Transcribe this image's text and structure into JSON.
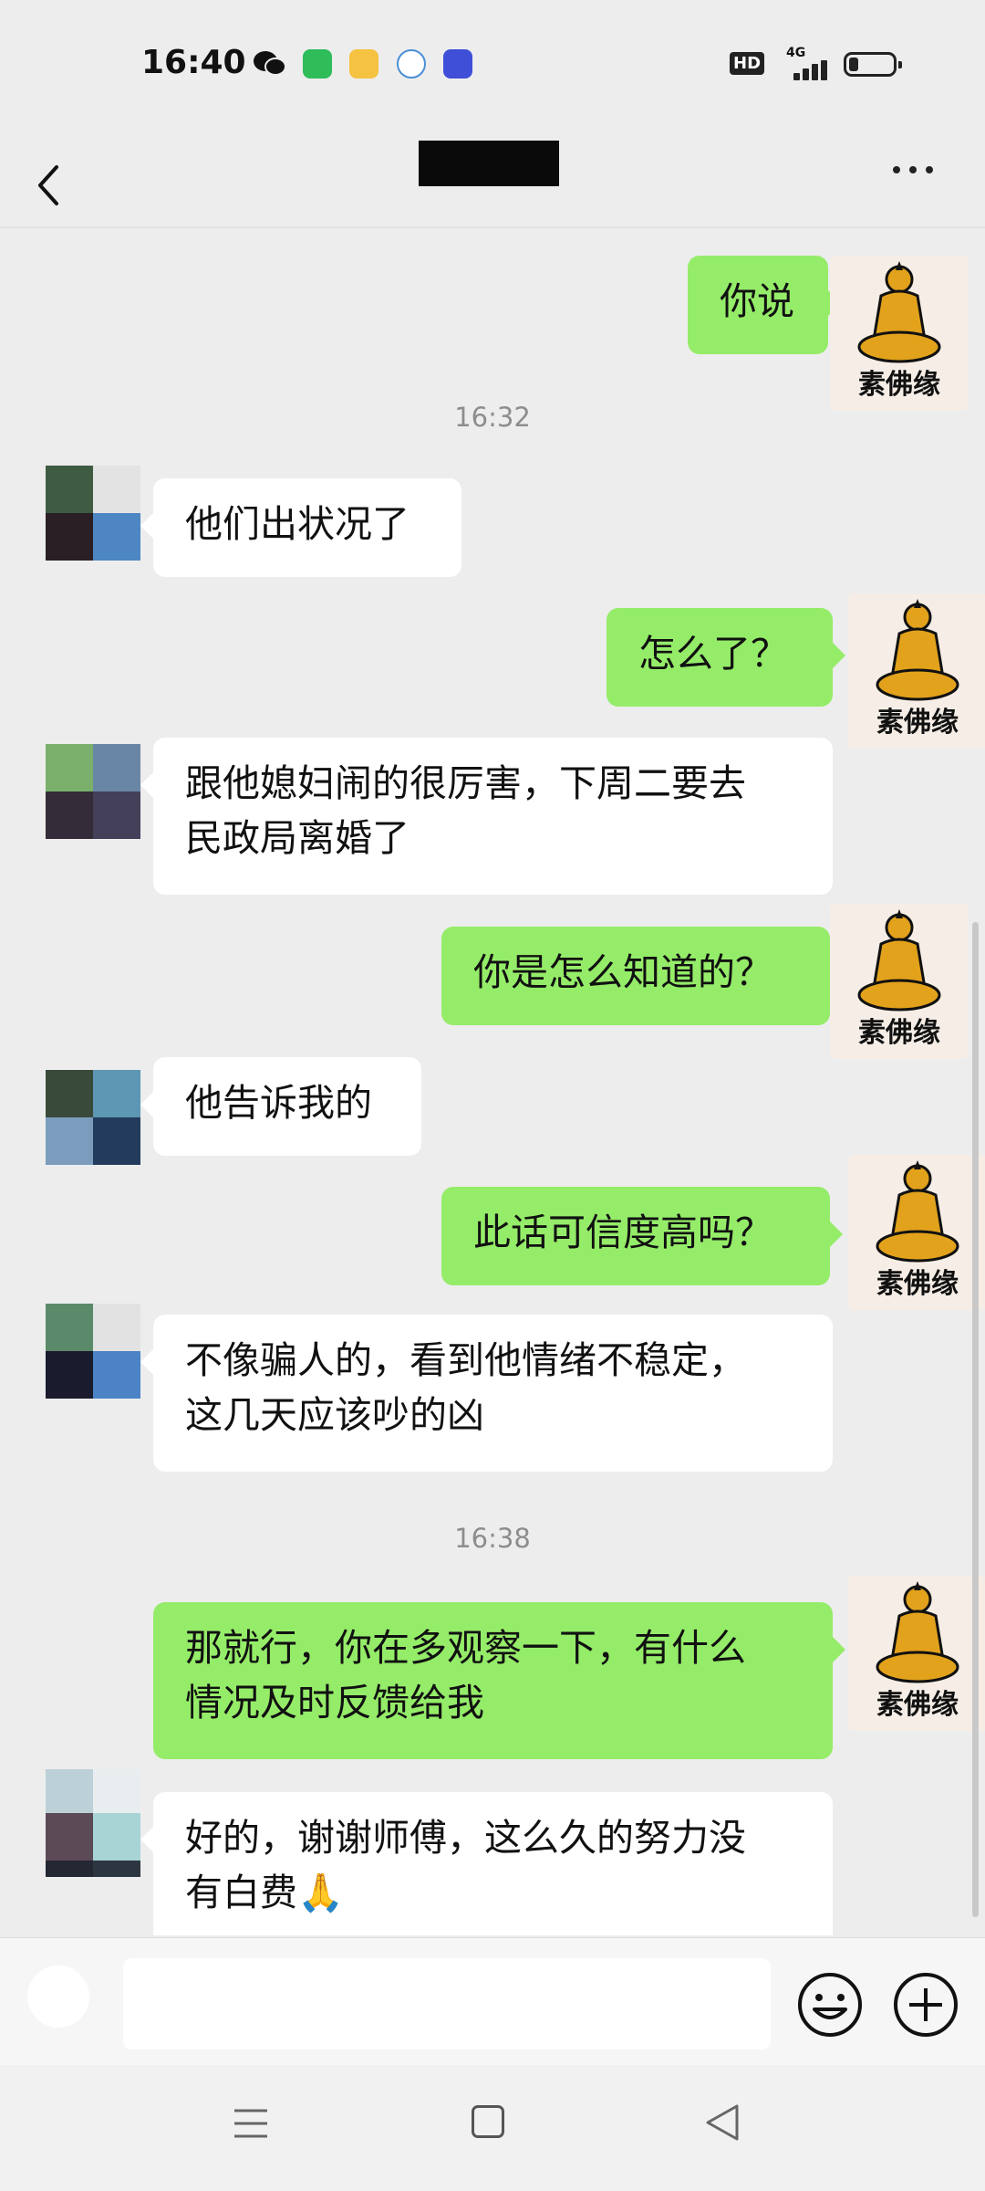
{
  "status_bar": {
    "time": "16:40",
    "app_icons": [
      {
        "name": "wechat-icon",
        "color": "#1aad19"
      },
      {
        "name": "shopping-bag-icon",
        "color": "#2ebd59"
      },
      {
        "name": "diamond-icon",
        "color": "#f5c341"
      },
      {
        "name": "ifly-icon",
        "color": "#4a8fd6"
      },
      {
        "name": "scissors-app-icon",
        "color": "#3f4fd8"
      }
    ],
    "hd_label": "HD",
    "network_label": "4G"
  },
  "header": {
    "title": "",
    "back_icon": "chevron-left-icon",
    "more_icon": "more-dots-icon"
  },
  "chat": {
    "timestamps": [
      "16:32",
      "16:38"
    ],
    "contact_avatar_caption": "素佛缘",
    "messages": [
      {
        "from": "me",
        "text": "你说"
      },
      {
        "from": "them",
        "text": "他们出状况了"
      },
      {
        "from": "me",
        "text": "怎么了？"
      },
      {
        "from": "them",
        "text": "跟他媳妇闹的很厉害，下周二要去\n民政局离婚了"
      },
      {
        "from": "me",
        "text": "你是怎么知道的？"
      },
      {
        "from": "them",
        "text": "他告诉我的"
      },
      {
        "from": "me",
        "text": "此话可信度高吗？"
      },
      {
        "from": "them",
        "text": "不像骗人的，看到他情绪不稳定，\n这几天应该吵的凶"
      },
      {
        "from": "me",
        "text": "那就行，你在多观察一下，有什么\n情况及时反馈给我"
      },
      {
        "from": "them",
        "text": "好的，谢谢师傅，这么久的努力没\n有白费🙏"
      }
    ]
  },
  "input_bar": {
    "placeholder": "",
    "emoji_icon": "emoji-smile-icon",
    "plus_icon": "plus-circle-icon"
  },
  "nav_bar": {
    "icons": [
      "menu-icon",
      "home-square-icon",
      "back-triangle-icon"
    ]
  },
  "colors": {
    "background": "#ededed",
    "outgoing_bubble": "#95ec69",
    "incoming_bubble": "#ffffff"
  }
}
